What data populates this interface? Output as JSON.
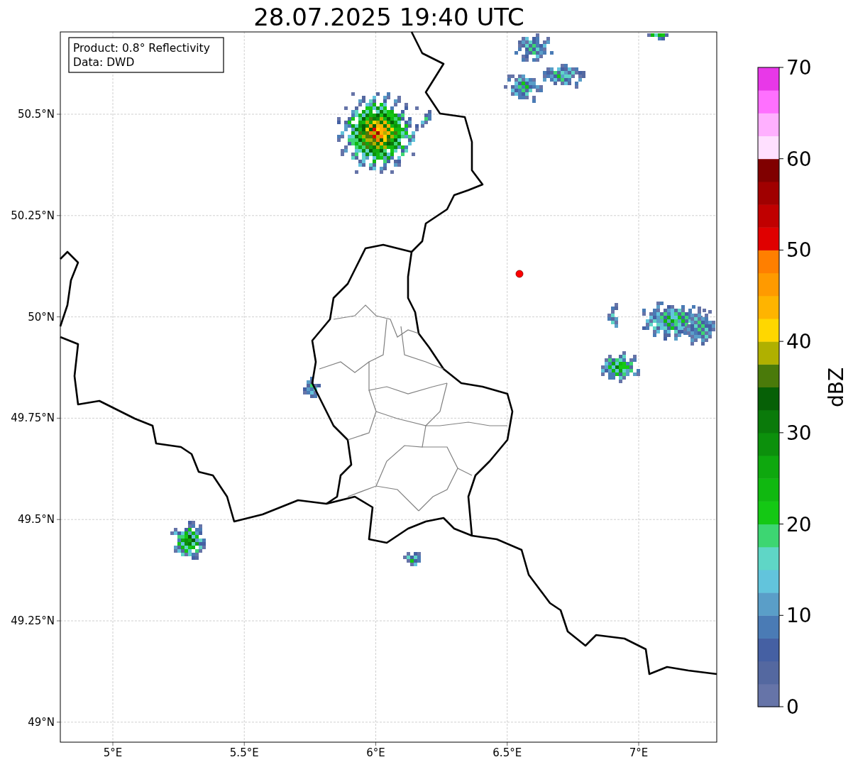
{
  "title": "28.07.2025 19:40 UTC",
  "info_box": [
    "Product: 0.8° Reflectivity",
    "Data: DWD"
  ],
  "x_ticks": [
    "5°E",
    "5.5°E",
    "6°E",
    "6.5°E",
    "7°E"
  ],
  "y_ticks": [
    "50.5°N",
    "50.25°N",
    "50°N",
    "49.75°N",
    "49.5°N",
    "49.25°N",
    "49°N"
  ],
  "colorbar": {
    "label": "dBZ",
    "ticks": [
      "70",
      "60",
      "50",
      "40",
      "30",
      "20",
      "10",
      "0"
    ],
    "bands": [
      {
        "color": "#6674a8"
      },
      {
        "color": "#5468a0"
      },
      {
        "color": "#4560a3"
      },
      {
        "color": "#4a7bb5"
      },
      {
        "color": "#5a9ec8"
      },
      {
        "color": "#62c4dc"
      },
      {
        "color": "#5fd6c6"
      },
      {
        "color": "#3dd672"
      },
      {
        "color": "#14c814"
      },
      {
        "color": "#10b810"
      },
      {
        "color": "#0ea80e"
      },
      {
        "color": "#0c900c"
      },
      {
        "color": "#0a7a0a"
      },
      {
        "color": "#066006"
      },
      {
        "color": "#4a7a0a"
      },
      {
        "color": "#b0b000"
      },
      {
        "color": "#ffd700"
      },
      {
        "color": "#ffb400"
      },
      {
        "color": "#ff9a00"
      },
      {
        "color": "#ff7f00"
      },
      {
        "color": "#e00000"
      },
      {
        "color": "#c00000"
      },
      {
        "color": "#a00000"
      },
      {
        "color": "#800000"
      },
      {
        "color": "#ffe0ff"
      },
      {
        "color": "#ffb0ff"
      },
      {
        "color": "#ff70ff"
      },
      {
        "color": "#e838e8"
      }
    ]
  }
}
